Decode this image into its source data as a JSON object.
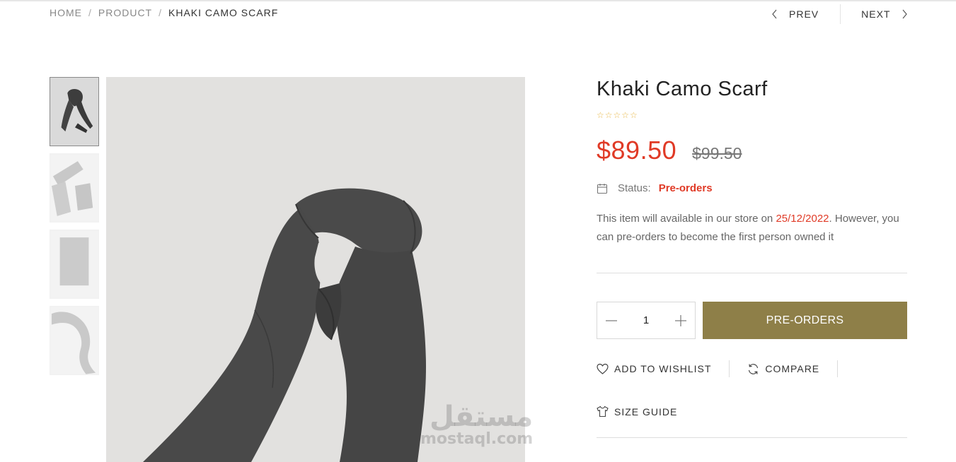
{
  "breadcrumb": {
    "home": "HOME",
    "product": "PRODUCT",
    "current": "KHAKI CAMO SCARF",
    "separator": "/"
  },
  "pager": {
    "prev": "PREV",
    "next": "NEXT"
  },
  "gallery": {
    "thumbnails": [
      {
        "name": "thumbnail-1",
        "active": true
      },
      {
        "name": "thumbnail-2",
        "active": false
      },
      {
        "name": "thumbnail-3",
        "active": false
      },
      {
        "name": "thumbnail-4",
        "active": false
      }
    ],
    "watermark_arabic": "مستقل",
    "watermark_latin": "mostaql.com"
  },
  "product": {
    "title": "Khaki Camo Scarf",
    "rating": {
      "value": 0,
      "max": 5,
      "stars": "☆☆☆☆☆"
    },
    "price": "$89.50",
    "old_price": "$99.50",
    "status_label": "Status:",
    "status_value": "Pre-orders",
    "description_before": "This item will available in our store on ",
    "description_date": "25/12/2022",
    "description_after": ". However, you can pre-orders to become the first person owned it",
    "quantity": "1",
    "preorder_button": "PRE-ORDERS",
    "wishlist": "ADD TO WISHLIST",
    "compare": "COMPARE",
    "size_guide": "SIZE GUIDE"
  },
  "colors": {
    "accent": "#e03a26",
    "button": "#8e7f48",
    "star": "#e8b84a"
  },
  "icons": [
    "chevron-left-icon",
    "chevron-right-icon",
    "calendar-icon",
    "minus-icon",
    "plus-icon",
    "heart-icon",
    "refresh-icon",
    "shirt-icon"
  ]
}
